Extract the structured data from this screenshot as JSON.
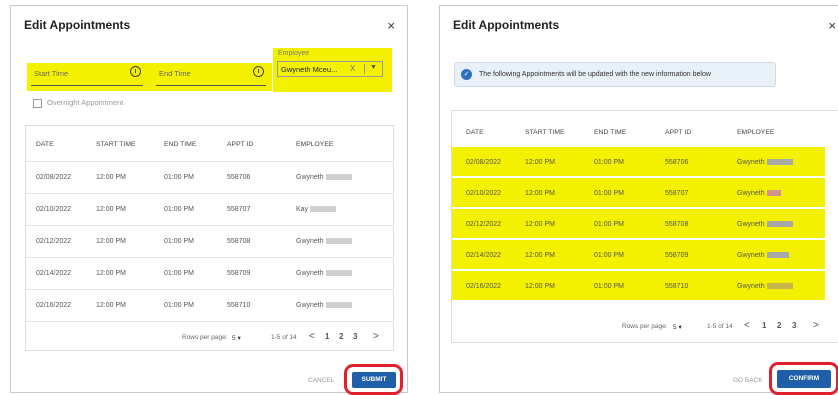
{
  "dialog1": {
    "title": "Edit Appointments",
    "close": "×",
    "start_time_placeholder": "Start Time",
    "end_time_placeholder": "End Time",
    "employee_label": "Employee",
    "employee_value": "Gwyneth Mceu...",
    "employee_clear": "X",
    "overnight_label": "Overnight Appointment",
    "columns": [
      "DATE",
      "START TIME",
      "END TIME",
      "APPT ID",
      "EMPLOYEE"
    ],
    "rows": [
      [
        "02/08/2022",
        "12:00 PM",
        "01:00 PM",
        "558706",
        "Gwyneth"
      ],
      [
        "02/10/2022",
        "12:00 PM",
        "01:00 PM",
        "558707",
        "Kay"
      ],
      [
        "02/12/2022",
        "12:00 PM",
        "01:00 PM",
        "558708",
        "Gwyneth"
      ],
      [
        "02/14/2022",
        "12:00 PM",
        "01:00 PM",
        "558709",
        "Gwyneth"
      ],
      [
        "02/16/2022",
        "12:00 PM",
        "01:00 PM",
        "558710",
        "Gwyneth"
      ]
    ],
    "rows_per_page_label": "Rows per page:",
    "rows_per_page_value": "5",
    "range": "1-5 of 14",
    "pages": [
      "1",
      "2",
      "3"
    ],
    "prev": "<",
    "next": ">",
    "cancel": "CANCEL",
    "submit": "SUBMIT"
  },
  "dialog2": {
    "title": "Edit Appointments",
    "close": "×",
    "info_text": "The following Appointments will be updated with the new information below",
    "columns": [
      "DATE",
      "START TIME",
      "END TIME",
      "APPT ID",
      "EMPLOYEE"
    ],
    "rows": [
      [
        "02/08/2022",
        "12:00 PM",
        "01:00 PM",
        "558706",
        "Gwyneth"
      ],
      [
        "02/10/2022",
        "12:00 PM",
        "01:00 PM",
        "558707",
        "Gwyneth"
      ],
      [
        "02/12/2022",
        "12:00 PM",
        "01:00 PM",
        "558708",
        "Gwyneth"
      ],
      [
        "02/14/2022",
        "12:00 PM",
        "01:00 PM",
        "558709",
        "Gwyneth"
      ],
      [
        "02/16/2022",
        "12:00 PM",
        "01:00 PM",
        "558710",
        "Gwyneth"
      ]
    ],
    "rows_per_page_label": "Rows per page:",
    "rows_per_page_value": "5",
    "range": "1-5 of 14",
    "pages": [
      "1",
      "2",
      "3"
    ],
    "prev": "<",
    "next": ">",
    "go_back": "GO BACK",
    "confirm": "CONFIRM"
  },
  "colors": {
    "highlight": "#f4f100",
    "primary_button": "#1f5ea8",
    "annotation_ring": "#e1202e",
    "info_icon": "#2f6fbf"
  }
}
